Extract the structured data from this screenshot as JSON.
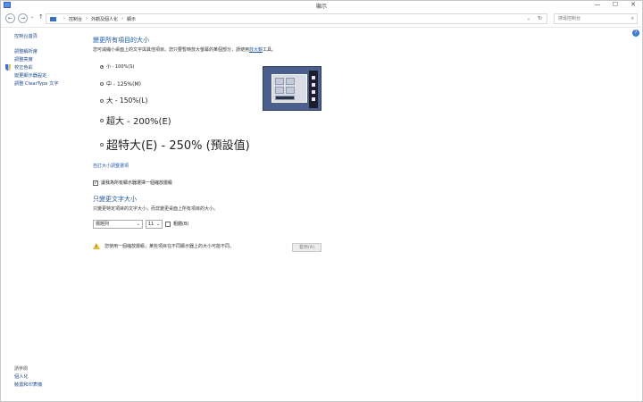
{
  "window": {
    "title": "顯示"
  },
  "window_buttons": {
    "minimize": "—",
    "maximize": "☐",
    "close": "✕"
  },
  "nav": {
    "back": "←",
    "forward": "→",
    "dropdown": "⌄",
    "up": "↑"
  },
  "address": {
    "breadcrumbs": [
      "控制台",
      "外觀及個人化",
      "顯示"
    ],
    "separator": "›",
    "dropdown": "⌄",
    "refresh": "↻"
  },
  "search": {
    "placeholder": "搜尋控制台",
    "icon": "search-icon",
    "glyph": "⌕"
  },
  "help": {
    "glyph": "?"
  },
  "sidebar": {
    "items": [
      {
        "label": "控制台首頁"
      },
      {
        "label": "調整解析度"
      },
      {
        "label": "調整亮度"
      },
      {
        "label": "校正色彩",
        "icon": "shield-icon"
      },
      {
        "label": "變更顯示器設定"
      },
      {
        "label": "調整 ClearType 文字"
      }
    ],
    "see_also": "請參閱",
    "bottom_items": [
      {
        "label": "個人化"
      },
      {
        "label": "裝置和印表機"
      }
    ]
  },
  "main": {
    "heading": "變更所有項目的大小",
    "description_prefix": "您可減縮小桌面上的文字與其他項目。您只要暫時放大螢幕的某個部分，請使用",
    "description_link": "放大鏡",
    "description_suffix": "工具。",
    "size_options": [
      {
        "label": "小 - 100%(S)",
        "selected": true
      },
      {
        "label": "中 - 125%(M)",
        "selected": false
      },
      {
        "label": "大 - 150%(L)",
        "selected": false
      },
      {
        "label": "超大 - 200%(E)",
        "selected": false
      },
      {
        "label": "超特大(E) - 250% (預設值)",
        "selected": false
      }
    ],
    "custom_link": "自訂大小調整選項",
    "checkbox_label": "讓我為所有顯示器選擇一個縮放層級",
    "checkbox_mark": "✓",
    "checkbox_checked": true,
    "text_heading": "只變更文字大小",
    "text_description": "只變更特定項目的文字大小，而非變更桌面上所有項目的大小。",
    "item_select": "標題列",
    "size_select": "11",
    "select_arrow": "⌄",
    "bold_label": "粗體(B)",
    "warning_glyph": "!",
    "warning_text": "您使用一個縮放層級，某些項目在不同顯示器上的大小可能不同。",
    "apply_label": "套用(A)"
  }
}
